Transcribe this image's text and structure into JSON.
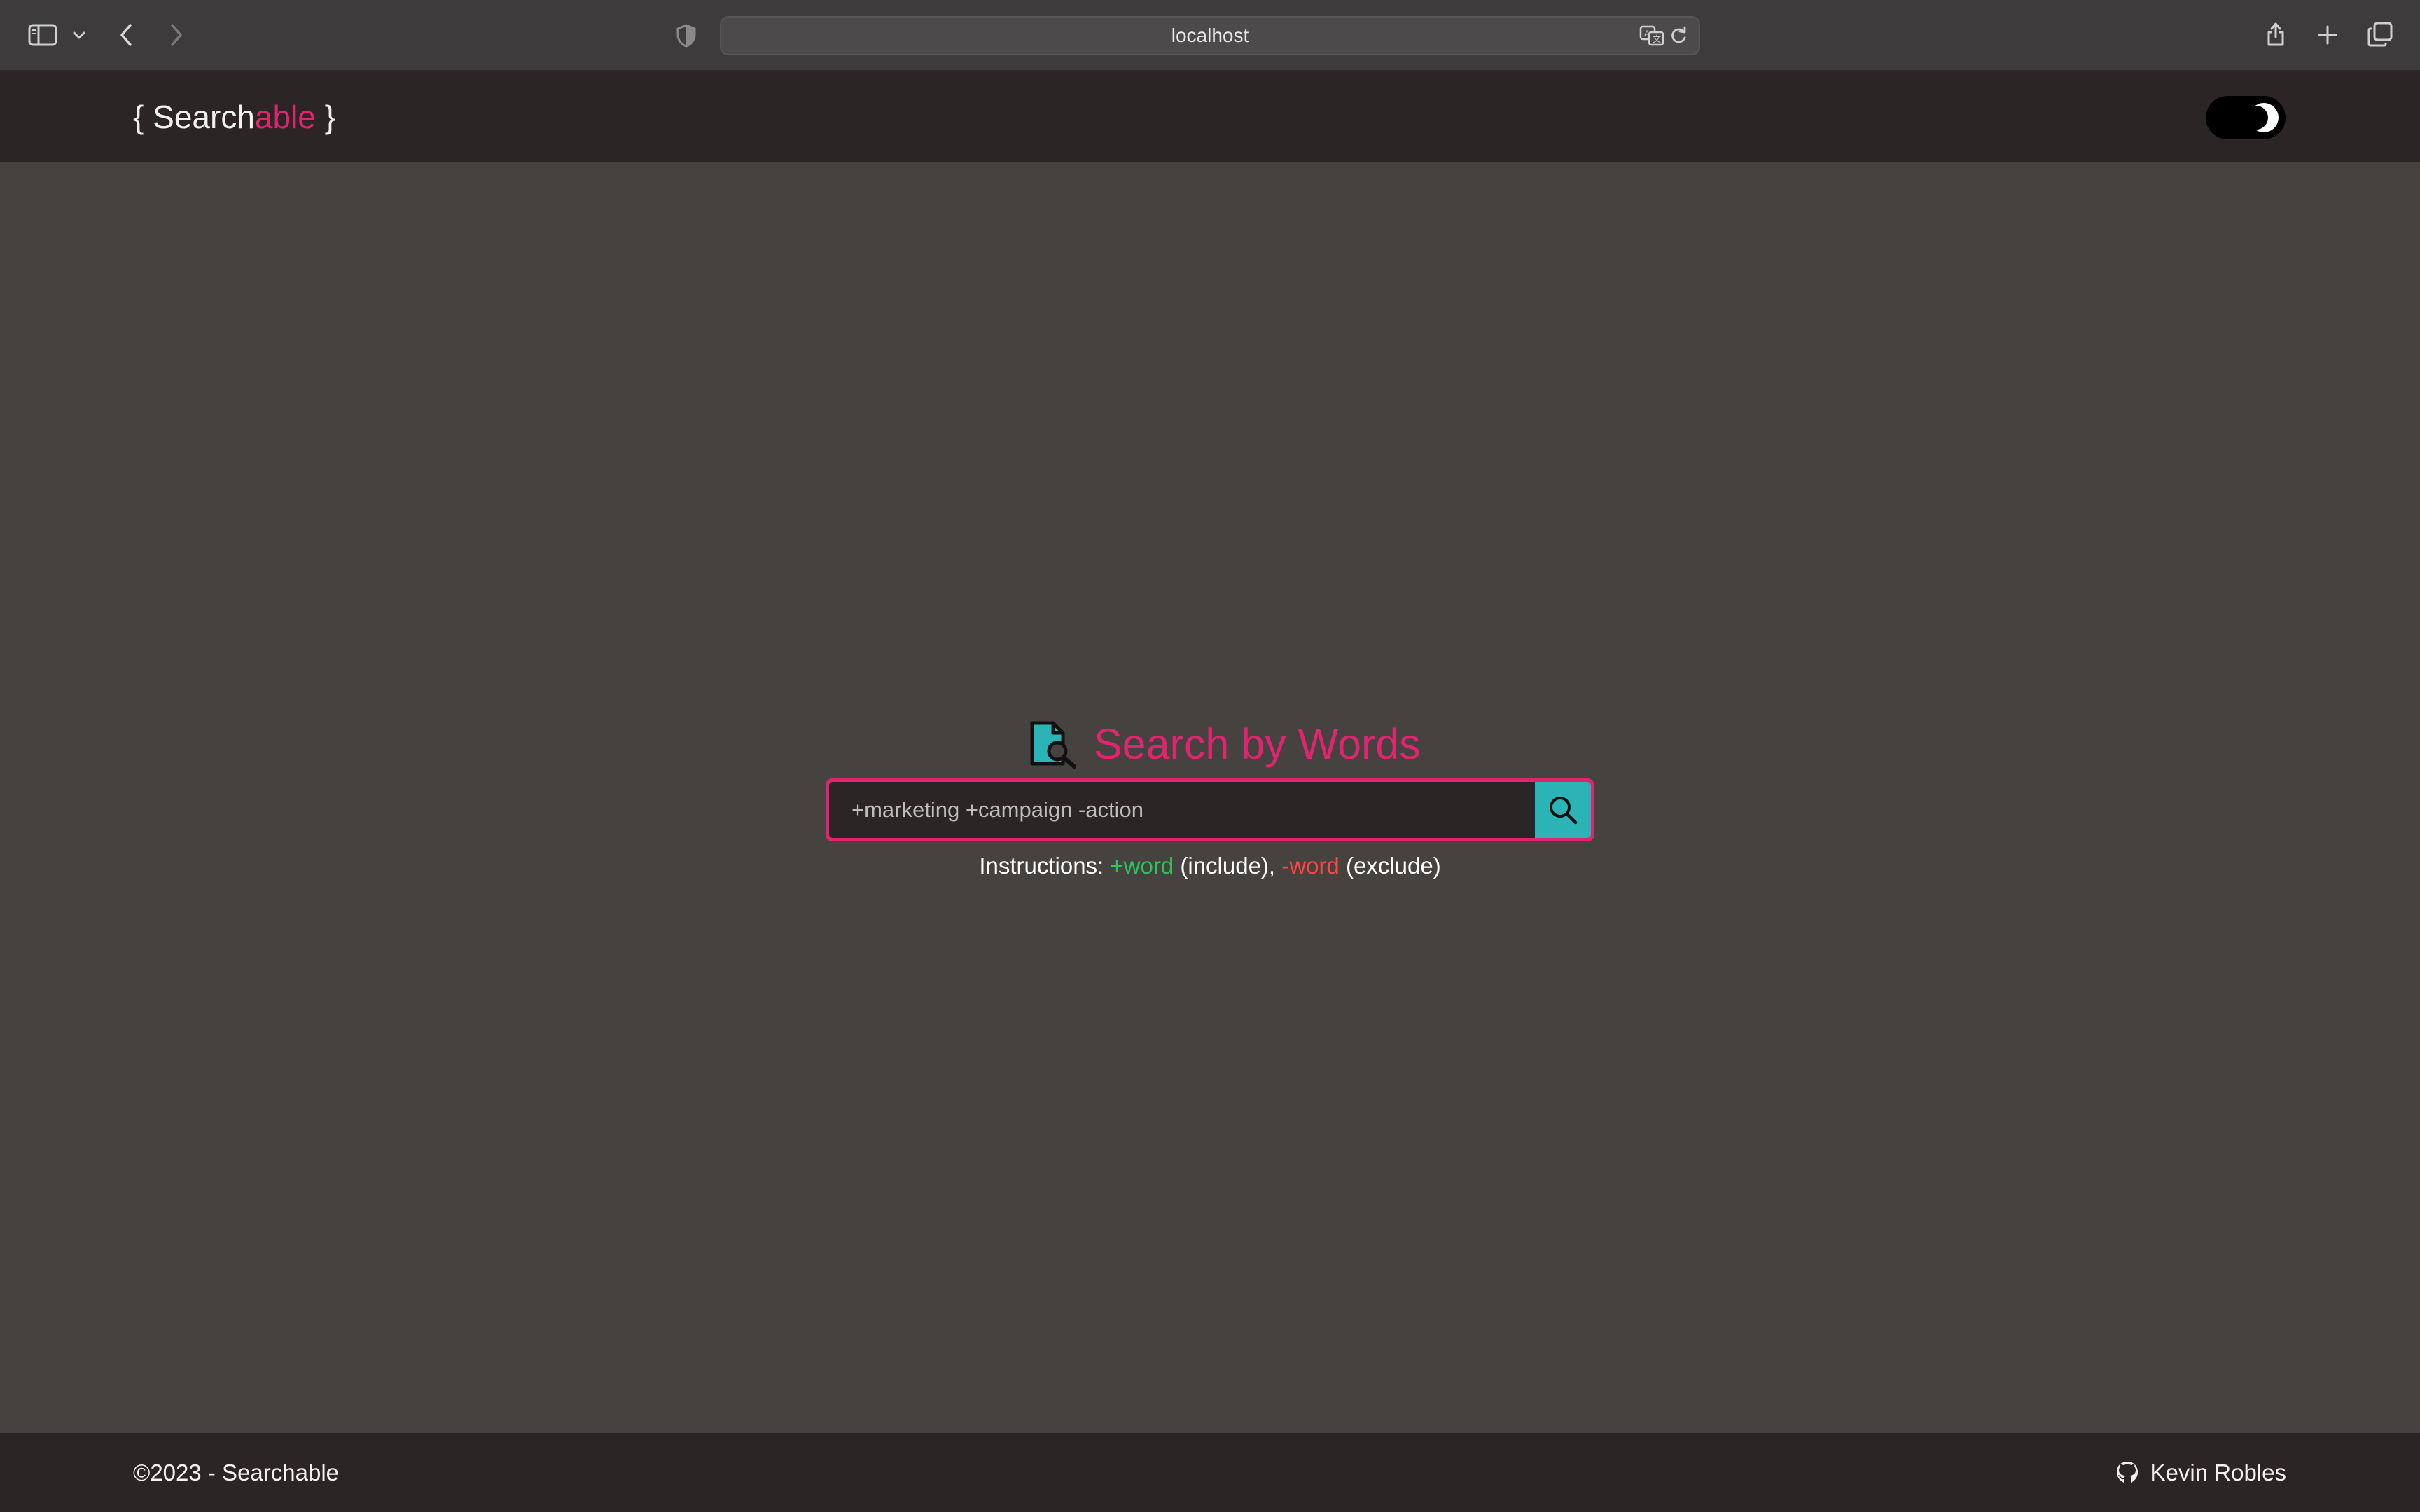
{
  "browser": {
    "url": "localhost",
    "icons": [
      "sidebar-icon",
      "chevron-down-icon",
      "back-icon",
      "forward-icon",
      "shield-icon",
      "translate-icon",
      "reload-icon",
      "share-icon",
      "new-tab-icon",
      "tabs-overview-icon"
    ]
  },
  "header": {
    "brand": {
      "open_brace": "{ ",
      "word_main": "Search",
      "word_accent": "able",
      "close_brace": " }"
    },
    "theme_toggle_icon": "moon-icon"
  },
  "search": {
    "title": "Search by Words",
    "title_icon": "document-search-icon",
    "placeholder": "+marketing +campaign -action",
    "value": "",
    "button_icon": "search-icon"
  },
  "instructions": {
    "prefix": "Instructions: ",
    "include_token": "+word",
    "include_text": " (include), ",
    "exclude_token": "-word",
    "exclude_text": " (exclude)"
  },
  "footer": {
    "copyright": "©2023 - Searchable",
    "author": "Kevin Robles",
    "author_icon": "github-icon"
  },
  "colors": {
    "accent": "#e0246f",
    "button": "#2bb3b6",
    "include": "#2ec25a",
    "exclude": "#ff4545",
    "page_bg": "#46423f",
    "bar_bg": "#2b2625"
  }
}
